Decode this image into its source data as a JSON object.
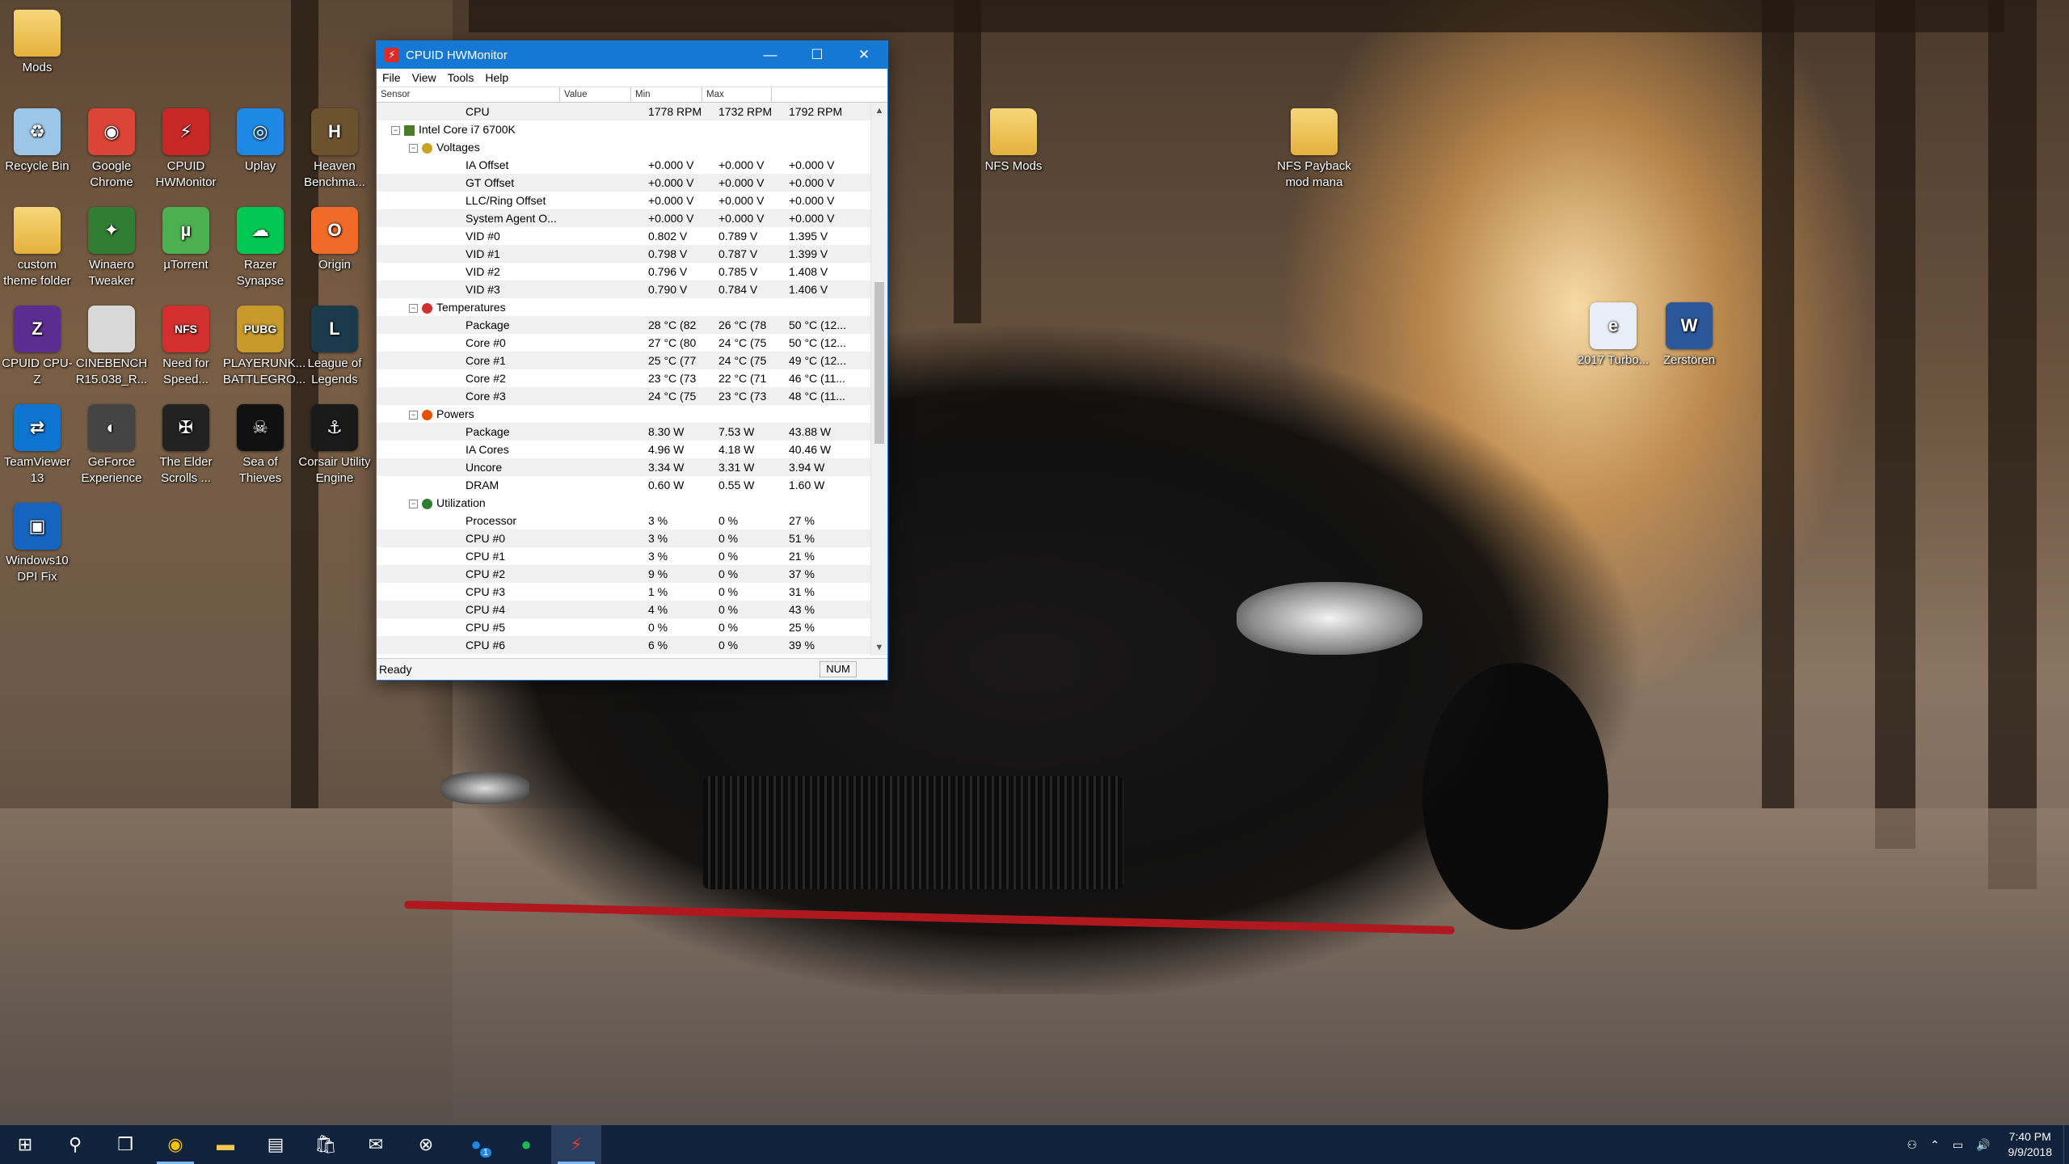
{
  "window": {
    "title": "CPUID HWMonitor",
    "menu": [
      "File",
      "View",
      "Tools",
      "Help"
    ],
    "columns": [
      "Sensor",
      "Value",
      "Min",
      "Max"
    ],
    "status": "Ready",
    "num_indicator": "NUM"
  },
  "rows": [
    {
      "kind": "leaf",
      "label": "CPU",
      "value": "1778 RPM",
      "min": "1732 RPM",
      "max": "1792 RPM"
    },
    {
      "kind": "device",
      "label": "Intel Core i7 6700K"
    },
    {
      "kind": "cat",
      "label": "Voltages",
      "icon": "voltage-icon"
    },
    {
      "kind": "leaf",
      "label": "IA Offset",
      "value": "+0.000 V",
      "min": "+0.000 V",
      "max": "+0.000 V"
    },
    {
      "kind": "leaf",
      "label": "GT Offset",
      "value": "+0.000 V",
      "min": "+0.000 V",
      "max": "+0.000 V"
    },
    {
      "kind": "leaf",
      "label": "LLC/Ring Offset",
      "value": "+0.000 V",
      "min": "+0.000 V",
      "max": "+0.000 V"
    },
    {
      "kind": "leaf",
      "label": "System Agent O...",
      "value": "+0.000 V",
      "min": "+0.000 V",
      "max": "+0.000 V"
    },
    {
      "kind": "leaf",
      "label": "VID #0",
      "value": "0.802 V",
      "min": "0.789 V",
      "max": "1.395 V"
    },
    {
      "kind": "leaf",
      "label": "VID #1",
      "value": "0.798 V",
      "min": "0.787 V",
      "max": "1.399 V"
    },
    {
      "kind": "leaf",
      "label": "VID #2",
      "value": "0.796 V",
      "min": "0.785 V",
      "max": "1.408 V"
    },
    {
      "kind": "leaf",
      "label": "VID #3",
      "value": "0.790 V",
      "min": "0.784 V",
      "max": "1.406 V"
    },
    {
      "kind": "cat",
      "label": "Temperatures",
      "icon": "thermometer-icon"
    },
    {
      "kind": "leaf",
      "label": "Package",
      "value": "28 °C (82",
      "min": "26 °C (78",
      "max": "50 °C (12..."
    },
    {
      "kind": "leaf",
      "label": "Core #0",
      "value": "27 °C (80",
      "min": "24 °C (75",
      "max": "50 °C (12..."
    },
    {
      "kind": "leaf",
      "label": "Core #1",
      "value": "25 °C (77",
      "min": "24 °C (75",
      "max": "49 °C (12..."
    },
    {
      "kind": "leaf",
      "label": "Core #2",
      "value": "23 °C (73",
      "min": "22 °C (71",
      "max": "46 °C (11..."
    },
    {
      "kind": "leaf",
      "label": "Core #3",
      "value": "24 °C (75",
      "min": "23 °C (73",
      "max": "48 °C (11..."
    },
    {
      "kind": "cat",
      "label": "Powers",
      "icon": "power-icon"
    },
    {
      "kind": "leaf",
      "label": "Package",
      "value": "8.30 W",
      "min": "7.53 W",
      "max": "43.88 W"
    },
    {
      "kind": "leaf",
      "label": "IA Cores",
      "value": "4.96 W",
      "min": "4.18 W",
      "max": "40.46 W"
    },
    {
      "kind": "leaf",
      "label": "Uncore",
      "value": "3.34 W",
      "min": "3.31 W",
      "max": "3.94 W"
    },
    {
      "kind": "leaf",
      "label": "DRAM",
      "value": "0.60 W",
      "min": "0.55 W",
      "max": "1.60 W"
    },
    {
      "kind": "cat",
      "label": "Utilization",
      "icon": "utilization-icon"
    },
    {
      "kind": "leaf",
      "label": "Processor",
      "value": "3 %",
      "min": "0 %",
      "max": "27 %"
    },
    {
      "kind": "leaf",
      "label": "CPU #0",
      "value": "3 %",
      "min": "0 %",
      "max": "51 %"
    },
    {
      "kind": "leaf",
      "label": "CPU #1",
      "value": "3 %",
      "min": "0 %",
      "max": "21 %"
    },
    {
      "kind": "leaf",
      "label": "CPU #2",
      "value": "9 %",
      "min": "0 %",
      "max": "37 %"
    },
    {
      "kind": "leaf",
      "label": "CPU #3",
      "value": "1 %",
      "min": "0 %",
      "max": "31 %"
    },
    {
      "kind": "leaf",
      "label": "CPU #4",
      "value": "4 %",
      "min": "0 %",
      "max": "43 %"
    },
    {
      "kind": "leaf",
      "label": "CPU #5",
      "value": "0 %",
      "min": "0 %",
      "max": "25 %"
    },
    {
      "kind": "leaf",
      "label": "CPU #6",
      "value": "6 %",
      "min": "0 %",
      "max": "39 %"
    }
  ],
  "desktop_icons": [
    {
      "label": "Mods",
      "icon": "folder-icon",
      "color": "#e8b43f",
      "glyph": ""
    },
    {
      "label": "Recycle Bin",
      "icon": "recycle-bin-icon",
      "color": "#9cc6e8",
      "glyph": "♻"
    },
    {
      "label": "Google Chrome",
      "icon": "chrome-icon",
      "color": "#db4437",
      "glyph": "◉"
    },
    {
      "label": "CPUID HWMonitor",
      "icon": "hwmonitor-icon",
      "color": "#c62828",
      "glyph": "⚡"
    },
    {
      "label": "Uplay",
      "icon": "uplay-icon",
      "color": "#1e88e5",
      "glyph": "◎"
    },
    {
      "label": "Heaven Benchma...",
      "icon": "heaven-icon",
      "color": "#6d5230",
      "glyph": "H"
    },
    {
      "label": "custom theme folder",
      "icon": "folder-icon",
      "color": "#e8b43f",
      "glyph": ""
    },
    {
      "label": "Winaero Tweaker",
      "icon": "winaero-icon",
      "color": "#2e7d32",
      "glyph": "✦"
    },
    {
      "label": "µTorrent",
      "icon": "utorrent-icon",
      "color": "#4caf50",
      "glyph": "µ"
    },
    {
      "label": "Razer Synapse",
      "icon": "razer-icon",
      "color": "#00c853",
      "glyph": "☁"
    },
    {
      "label": "Origin",
      "icon": "origin-icon",
      "color": "#f06a2a",
      "glyph": "O"
    },
    {
      "label": "CPUID CPU-Z",
      "icon": "cpuz-icon",
      "color": "#5c2d91",
      "glyph": "Z"
    },
    {
      "label": "CINEBENCH R15.038_R...",
      "icon": "cinebench-icon",
      "color": "#d8d8d8",
      "glyph": ""
    },
    {
      "label": "Need for Speed...",
      "icon": "nfs-icon",
      "color": "#d32f2f",
      "glyph": "NFS"
    },
    {
      "label": "PLAYERUNK... BATTLEGRO...",
      "icon": "pubg-icon",
      "color": "#c79a2c",
      "glyph": "PUBG"
    },
    {
      "label": "League of Legends",
      "icon": "lol-icon",
      "color": "#1b3a4b",
      "glyph": "L"
    },
    {
      "label": "TeamViewer 13",
      "icon": "teamviewer-icon",
      "color": "#0e74d2",
      "glyph": "⇄"
    },
    {
      "label": "GeForce Experience",
      "icon": "geforce-icon",
      "color": "#444",
      "glyph": "◐"
    },
    {
      "label": "The Elder Scrolls ...",
      "icon": "elder-scrolls-icon",
      "color": "#222",
      "glyph": "✠"
    },
    {
      "label": "Sea of Thieves",
      "icon": "sea-of-thieves-icon",
      "color": "#111",
      "glyph": "☠"
    },
    {
      "label": "Corsair Utility Engine",
      "icon": "corsair-icon",
      "color": "#1a1a1a",
      "glyph": "⚓"
    },
    {
      "label": "Windows10 DPI Fix",
      "icon": "dpi-fix-icon",
      "color": "#1565c0",
      "glyph": "▣"
    },
    {
      "label": "NFS Mods",
      "icon": "folder-icon",
      "color": "#e8b43f",
      "glyph": ""
    },
    {
      "label": "NFS Payback mod mana",
      "icon": "folder-icon",
      "color": "#e8b43f",
      "glyph": ""
    },
    {
      "label": "2017 Turbo...",
      "icon": "pdf-icon",
      "color": "#e8eef7",
      "glyph": "e"
    },
    {
      "label": "Zerstören",
      "icon": "word-doc-icon",
      "color": "#2b579a",
      "glyph": "W"
    }
  ],
  "taskbar": {
    "items": [
      "start-icon",
      "search-icon",
      "task-view-icon",
      "chrome-icon",
      "file-explorer-icon",
      "notepad-icon",
      "store-icon",
      "mail-icon",
      "xbox-icon",
      "messenger-icon",
      "spotify-icon",
      "hwmonitor-icon"
    ],
    "badge": "1",
    "time": "7:40 PM",
    "date": "9/9/2018"
  }
}
